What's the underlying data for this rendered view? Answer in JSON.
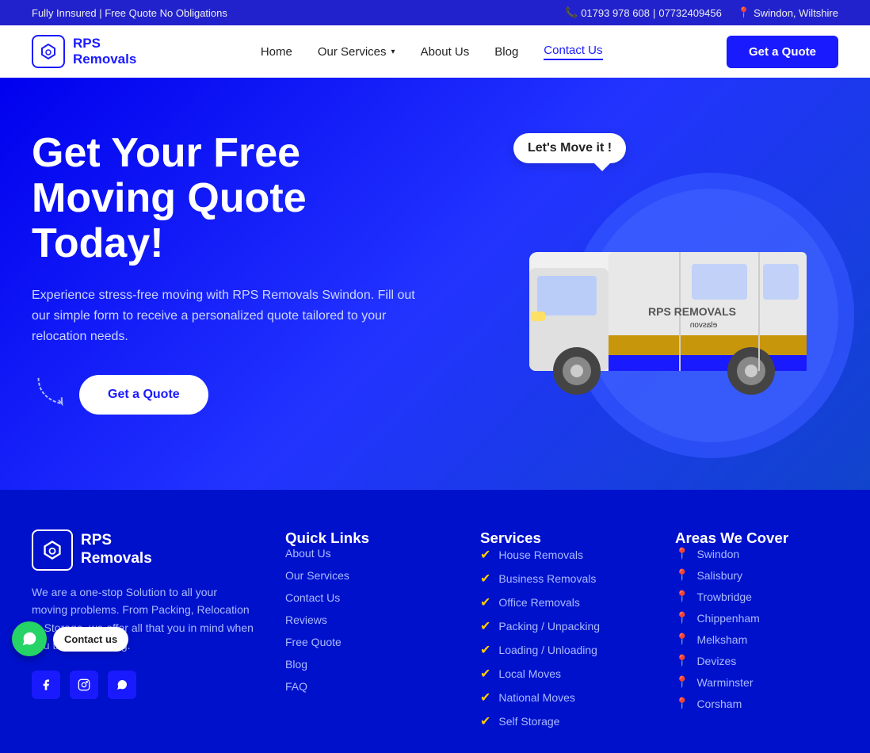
{
  "topbar": {
    "left_text": "Fully Innsured  |  Free Quote No Obligations",
    "phone1": "01793 978 608",
    "phone_separator": "|",
    "phone2": "07732409456",
    "location": "Swindon, Wiltshire"
  },
  "header": {
    "logo_name": "RPS",
    "logo_subtitle": "Removals",
    "nav": {
      "home": "Home",
      "services": "Our Services",
      "about": "About Us",
      "blog": "Blog",
      "contact": "Contact Us"
    },
    "cta_button": "Get a Quote"
  },
  "hero": {
    "title": "Get Your Free Moving Quote Today!",
    "description": "Experience stress-free moving with RPS Removals Swindon. Fill out our simple form to receive a personalized quote tailored to your relocation needs.",
    "cta_button": "Get a Quote",
    "speech_bubble": "Let's Move it !"
  },
  "footer": {
    "logo_name": "RPS",
    "logo_subtitle": "Removals",
    "description": "We are a one-stop Solution to all your moving problems. From Packing, Relocation to Storage, we offer all that you in mind when you think of moving.",
    "quick_links_title": "Quick Links",
    "quick_links": [
      "About Us",
      "Our Services",
      "Contact Us",
      "Reviews",
      "Free Quote",
      "Blog",
      "FAQ"
    ],
    "services_title": "Services",
    "services": [
      "House Removals",
      "Business Removals",
      "Office Removals",
      "Packing / Unpacking",
      "Loading / Unloading",
      "Local Moves",
      "National Moves",
      "Self Storage"
    ],
    "areas_title": "Areas We Cover",
    "areas": [
      "Swindon",
      "Salisbury",
      "Trowbridge",
      "Chippenham",
      "Melksham",
      "Devizes",
      "Warminster",
      "Corsham"
    ]
  },
  "whatsapp": {
    "label": "Contact us"
  }
}
